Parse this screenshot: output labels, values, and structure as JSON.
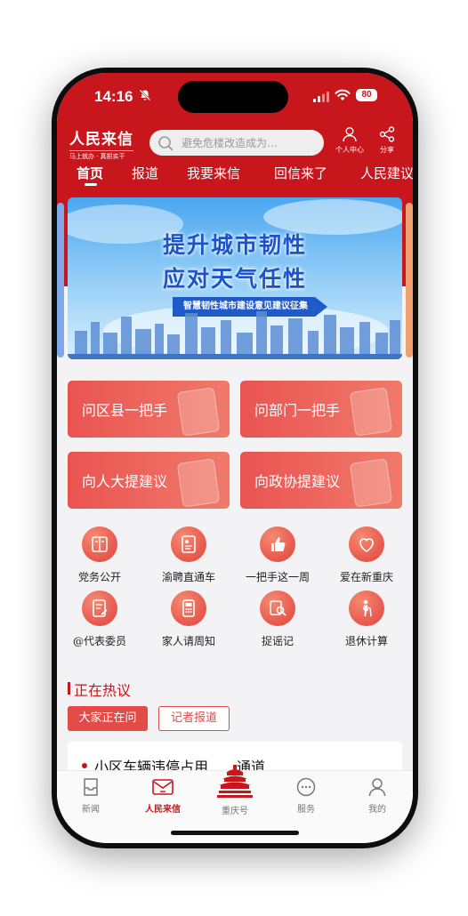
{
  "status_bar": {
    "time": "14:16",
    "battery": "80"
  },
  "header": {
    "brand_title": "人民来信",
    "brand_subtitle": "马上就办 · 真抓实干",
    "search_placeholder": "避免危楼改造成为…",
    "user_center_label": "个人中心",
    "share_label": "分享"
  },
  "tabs": [
    "首页",
    "报道",
    "我要来信",
    "回信来了",
    "人民建议"
  ],
  "banner": {
    "line1": "提升城市韧性",
    "line2": "应对天气任性",
    "ribbon": "智慧韧性城市建设意见建议征集"
  },
  "cards": [
    "问区县一把手",
    "问部门一把手",
    "向人大提建议",
    "向政协提建议"
  ],
  "quick_items": [
    {
      "label": "党务公开",
      "icon": "book-icon"
    },
    {
      "label": "渝聘直通车",
      "icon": "resume-icon"
    },
    {
      "label": "一把手这一周",
      "icon": "thumb-up-icon"
    },
    {
      "label": "爱在新重庆",
      "icon": "heart-logo-icon"
    },
    {
      "label": "@代表委员",
      "icon": "document-edit-icon"
    },
    {
      "label": "家人请周知",
      "icon": "phone-icon"
    },
    {
      "label": "捉谣记",
      "icon": "magnifier-icon"
    },
    {
      "label": "退休计算",
      "icon": "elder-icon"
    }
  ],
  "hot": {
    "title": "正在热议",
    "pill_active": "大家正在问",
    "pill_inactive": "记者报道",
    "first_item": "小区车辆违停占用　　通道"
  },
  "bottom_nav": [
    {
      "label": "新闻",
      "icon": "news-icon"
    },
    {
      "label": "人民来信",
      "icon": "mail-icon"
    },
    {
      "label": "重庆号",
      "icon": "great-hall-icon"
    },
    {
      "label": "服务",
      "icon": "chat-icon"
    },
    {
      "label": "我的",
      "icon": "profile-icon"
    }
  ],
  "colors": {
    "brand_red": "#c8161d",
    "card_red": "#ea5452",
    "banner_blue": "#1c53c9"
  }
}
